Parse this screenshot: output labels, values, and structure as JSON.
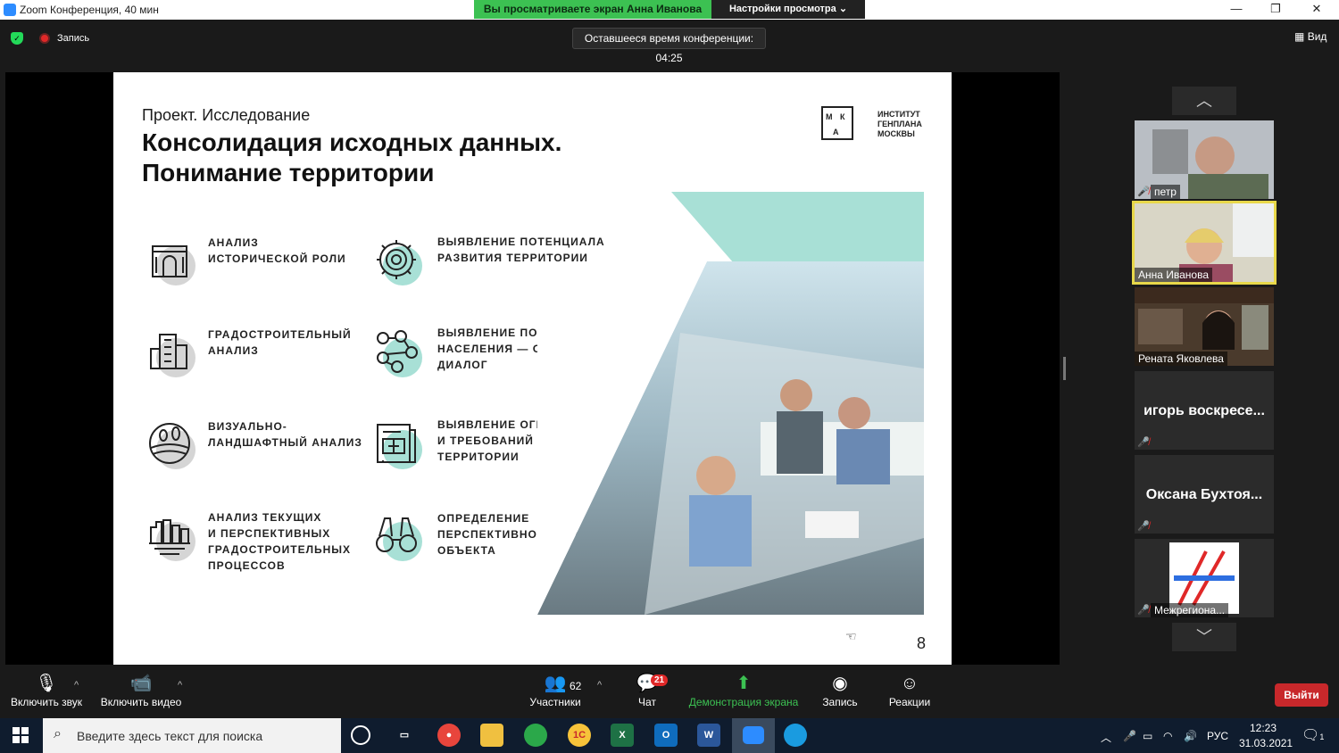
{
  "window": {
    "title": "Zoom Конференция, 40 мин",
    "share_banner": "Вы просматриваете экран Анна Иванова",
    "view_settings": "Настройки просмотра ⌄",
    "min": "—",
    "max": "❐",
    "close": "✕"
  },
  "meeting_bar": {
    "recording": "Запись",
    "time_left": "Оставшееся время конференции: 04:25",
    "view": "Вид",
    "view_icon": "▦"
  },
  "slide": {
    "subtitle": "Проект. Исследование",
    "headline_1": "Консолидация исходных данных.",
    "headline_2": "Понимание территории",
    "logo_letters": [
      "М",
      "К",
      "А"
    ],
    "logo_text_1": "ИНСТИТУТ",
    "logo_text_2": "ГЕНПЛАНА",
    "logo_text_3": "МОСКВЫ",
    "page_number": "8",
    "items": [
      {
        "icon": "historic-building-icon",
        "color": "#d5d5d5",
        "line1": "АНАЛИЗ",
        "line2": "ИСТОРИЧЕСКОЙ РОЛИ",
        "line3": "",
        "line4": ""
      },
      {
        "icon": "urban-buildings-icon",
        "color": "#d5d5d5",
        "line1": "ГРАДОСТРОИТЕЛЬНЫЙ",
        "line2": "АНАЛИЗ",
        "line3": "",
        "line4": ""
      },
      {
        "icon": "landscape-icon",
        "color": "#d5d5d5",
        "line1": "ВИЗУАЛЬНО-",
        "line2": "ЛАНДШАФТНЫЙ АНАЛИЗ",
        "line3": "",
        "line4": ""
      },
      {
        "icon": "city-processes-icon",
        "color": "#d5d5d5",
        "line1": "АНАЛИЗ ТЕКУЩИХ",
        "line2": "И ПЕРСПЕКТИВНЫХ",
        "line3": "ГРАДОСТРОИТЕЛЬНЫХ",
        "line4": "ПРОЦЕССОВ"
      },
      {
        "icon": "gear-icon",
        "color": "#a8e0d6",
        "line1": "ВЫЯВЛЕНИЕ ПОТЕНЦИАЛА",
        "line2": "РАЗВИТИЯ ТЕРРИТОРИИ",
        "line3": "",
        "line4": ""
      },
      {
        "icon": "people-network-icon",
        "color": "#a8e0d6",
        "line1": "ВЫЯВЛЕНИЕ ПОТРЕБНОСТЕЙ",
        "line2": "НАСЕЛЕНИЯ — ОТКРЫТЫЙ",
        "line3": "ДИАЛОГ",
        "line4": ""
      },
      {
        "icon": "document-plan-icon",
        "color": "#a8e0d6",
        "line1": "ВЫЯВЛЕНИЕ ОГРАНИЧЕНИЙ",
        "line2": "И ТРЕБОВАНИЙ К РАЗВИТИЮ",
        "line3": "ТЕРРИТОРИИ",
        "line4": ""
      },
      {
        "icon": "binoculars-icon",
        "color": "#a8e0d6",
        "line1": "ОПРЕДЕЛЕНИЕ",
        "line2": "ПЕРСПЕКТИВНОЙ РОЛИ",
        "line3": "ОБЪЕКТА",
        "line4": ""
      }
    ]
  },
  "participants": [
    {
      "name": "петр",
      "type": "video",
      "muted": true
    },
    {
      "name": "Анна Иванова",
      "type": "video",
      "muted": false,
      "active": true
    },
    {
      "name": "Рената Яковлева",
      "type": "video",
      "muted": false
    },
    {
      "name": "игорь воскресе...",
      "type": "name",
      "muted": true
    },
    {
      "name": "Оксана Бухтоя...",
      "type": "name",
      "muted": true
    },
    {
      "name": "Межрегиона...",
      "type": "logo",
      "muted": true
    }
  ],
  "nav": {
    "up": "︿",
    "down": "﹀"
  },
  "toolbar": {
    "audio": "Включить звук",
    "video": "Включить видео",
    "participants": "Участники",
    "participants_count": "62",
    "chat": "Чат",
    "chat_badge": "21",
    "share": "Демонстрация экрана",
    "record": "Запись",
    "reactions": "Реакции",
    "leave": "Выйти",
    "caret": "^"
  },
  "taskbar": {
    "search_placeholder": "Введите здесь текст для поиска",
    "lang": "РУС",
    "time": "12:23",
    "date": "31.03.2021",
    "notif_count": "1"
  },
  "colors": {
    "accent_mint": "#a8e0d6",
    "banner_green": "#3cc152",
    "leave_red": "#c8282b",
    "active_border": "#e8d84a"
  }
}
